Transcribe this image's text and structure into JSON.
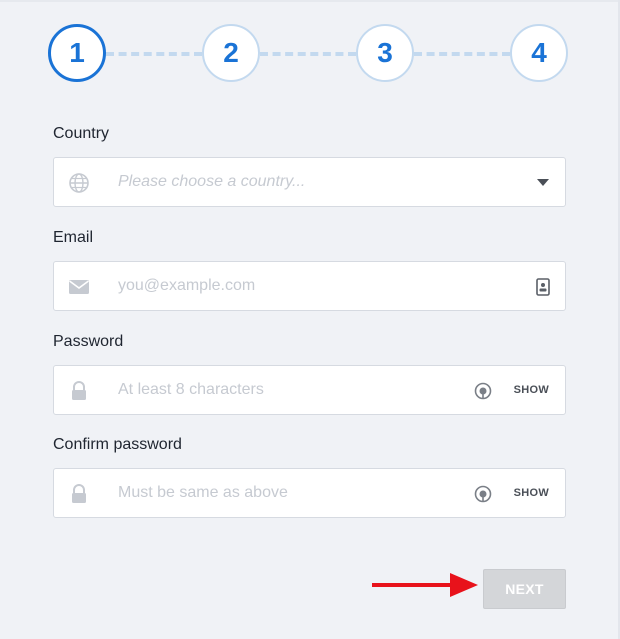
{
  "stepper": {
    "steps": [
      {
        "number": "1",
        "state": "active"
      },
      {
        "number": "2",
        "state": "upcoming"
      },
      {
        "number": "3",
        "state": "upcoming"
      },
      {
        "number": "4",
        "state": "upcoming"
      }
    ]
  },
  "form": {
    "country": {
      "label": "Country",
      "placeholder": "Please choose a country...",
      "leading_icon": "globe-icon",
      "trailing_icon": "dropdown-caret-icon"
    },
    "email": {
      "label": "Email",
      "placeholder": "you@example.com",
      "leading_icon": "envelope-icon",
      "trailing_icon": "contact-card-icon"
    },
    "password": {
      "label": "Password",
      "placeholder": "At least 8 characters",
      "leading_icon": "lock-icon",
      "trailing_icon": "password-manager-icon",
      "show_label": "SHOW"
    },
    "confirm_password": {
      "label": "Confirm password",
      "placeholder": "Must be same as above",
      "leading_icon": "lock-icon",
      "trailing_icon": "password-manager-icon",
      "show_label": "SHOW"
    }
  },
  "actions": {
    "next_label": "NEXT",
    "next_state": "disabled"
  },
  "colors": {
    "accent": "#1a73d6",
    "step_border": "#c3d9ef",
    "background": "#f0f2f6",
    "annotation_arrow": "#e8121b",
    "disabled_button": "#d4d6d9"
  }
}
